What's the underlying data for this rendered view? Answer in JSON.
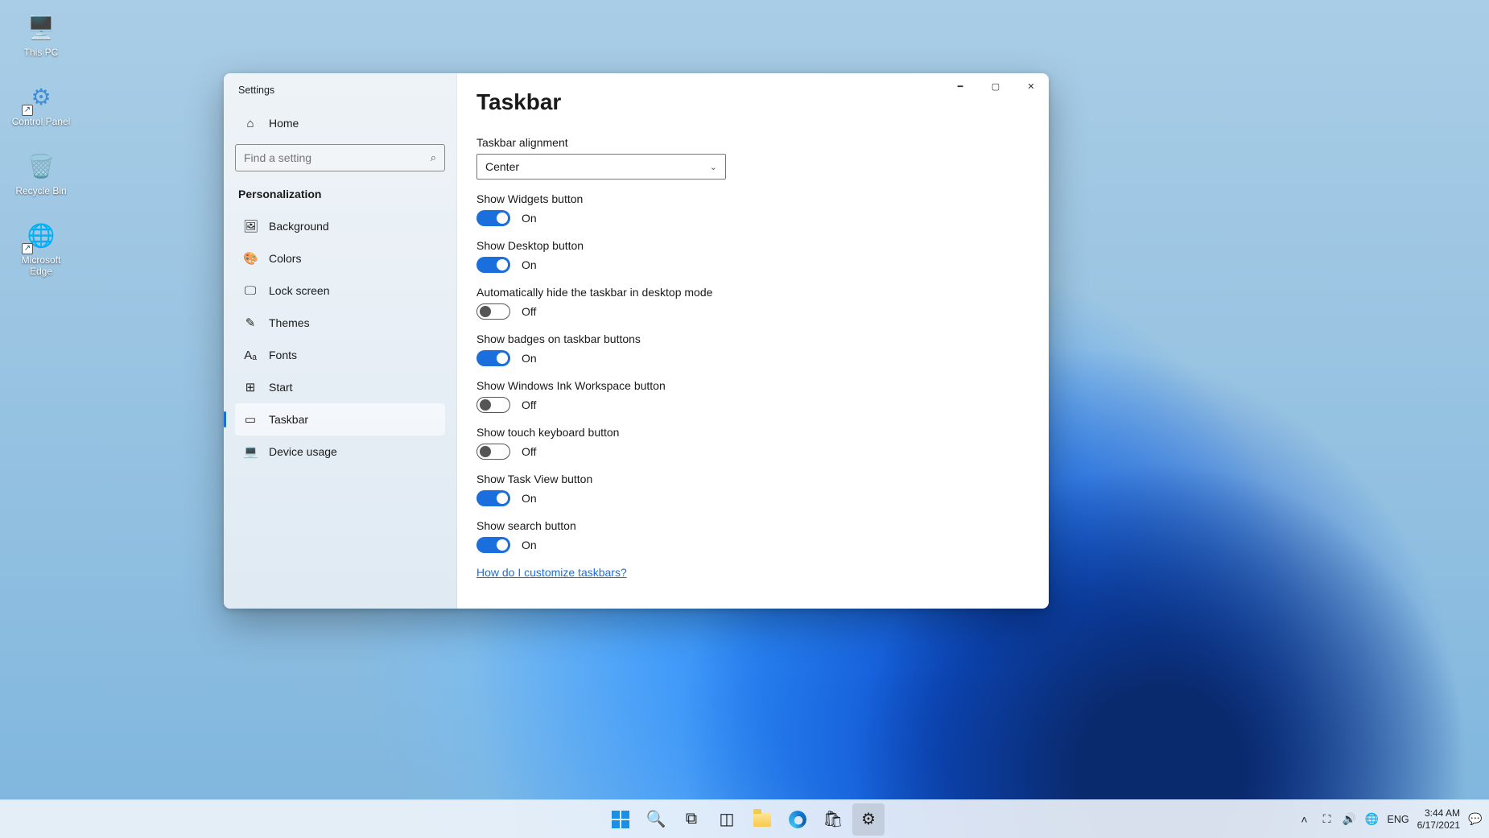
{
  "desktop_icons": [
    {
      "id": "this-pc",
      "label": "This PC",
      "glyph": "🖥️",
      "color": "#4aa3e0",
      "shortcut": false
    },
    {
      "id": "control-panel",
      "label": "Control Panel",
      "glyph": "⚙",
      "color": "#3f8ed6",
      "shortcut": true
    },
    {
      "id": "recycle-bin",
      "label": "Recycle Bin",
      "glyph": "🗑️",
      "color": "#ffffff",
      "shortcut": false
    },
    {
      "id": "edge",
      "label": "Microsoft\nEdge",
      "glyph": "🌐",
      "color": "#2f9ee8",
      "shortcut": true
    }
  ],
  "settings": {
    "window_title": "Settings",
    "search_placeholder": "Find a setting",
    "home_label": "Home",
    "section": "Personalization",
    "nav": [
      {
        "id": "background",
        "label": "Background",
        "icon": "🖼"
      },
      {
        "id": "colors",
        "label": "Colors",
        "icon": "🎨"
      },
      {
        "id": "lock-screen",
        "label": "Lock screen",
        "icon": "🖵"
      },
      {
        "id": "themes",
        "label": "Themes",
        "icon": "✎"
      },
      {
        "id": "fonts",
        "label": "Fonts",
        "icon": "A͏ₐ"
      },
      {
        "id": "start",
        "label": "Start",
        "icon": "⊞"
      },
      {
        "id": "taskbar",
        "label": "Taskbar",
        "icon": "▭",
        "active": true
      },
      {
        "id": "device-usage",
        "label": "Device usage",
        "icon": "💻"
      }
    ],
    "page_title": "Taskbar",
    "alignment": {
      "label": "Taskbar alignment",
      "value": "Center"
    },
    "toggles": [
      {
        "id": "widgets",
        "label": "Show Widgets button",
        "on": true
      },
      {
        "id": "desktop",
        "label": "Show Desktop button",
        "on": true
      },
      {
        "id": "autohide",
        "label": "Automatically hide the taskbar in desktop mode",
        "on": false
      },
      {
        "id": "badges",
        "label": "Show badges on taskbar buttons",
        "on": true
      },
      {
        "id": "ink",
        "label": "Show Windows Ink Workspace button",
        "on": false
      },
      {
        "id": "touchkb",
        "label": "Show touch keyboard button",
        "on": false
      },
      {
        "id": "taskview",
        "label": "Show Task View button",
        "on": true
      },
      {
        "id": "search",
        "label": "Show search button",
        "on": true
      }
    ],
    "state_labels": {
      "on": "On",
      "off": "Off"
    },
    "help_link": "How do I customize taskbars?"
  },
  "taskbar": {
    "apps": [
      {
        "id": "start",
        "name": "start-button",
        "glyph": "winlogo"
      },
      {
        "id": "search",
        "name": "search-button",
        "glyph": "🔍"
      },
      {
        "id": "taskview",
        "name": "task-view-button",
        "glyph": "⧉"
      },
      {
        "id": "widgets",
        "name": "widgets-button",
        "glyph": "◫"
      },
      {
        "id": "explorer",
        "name": "file-explorer-button",
        "glyph": "folder"
      },
      {
        "id": "edge",
        "name": "edge-button",
        "glyph": "edge"
      },
      {
        "id": "store",
        "name": "store-button",
        "glyph": "🛍"
      },
      {
        "id": "settings",
        "name": "settings-button",
        "glyph": "⚙",
        "active": true
      }
    ],
    "tray": {
      "overflow": "˄",
      "icons": [
        "⛶",
        "🔊",
        "🌐"
      ],
      "ime": "ENG",
      "time": "3:44 AM",
      "date": "6/17/2021",
      "action_center": "💬"
    }
  }
}
